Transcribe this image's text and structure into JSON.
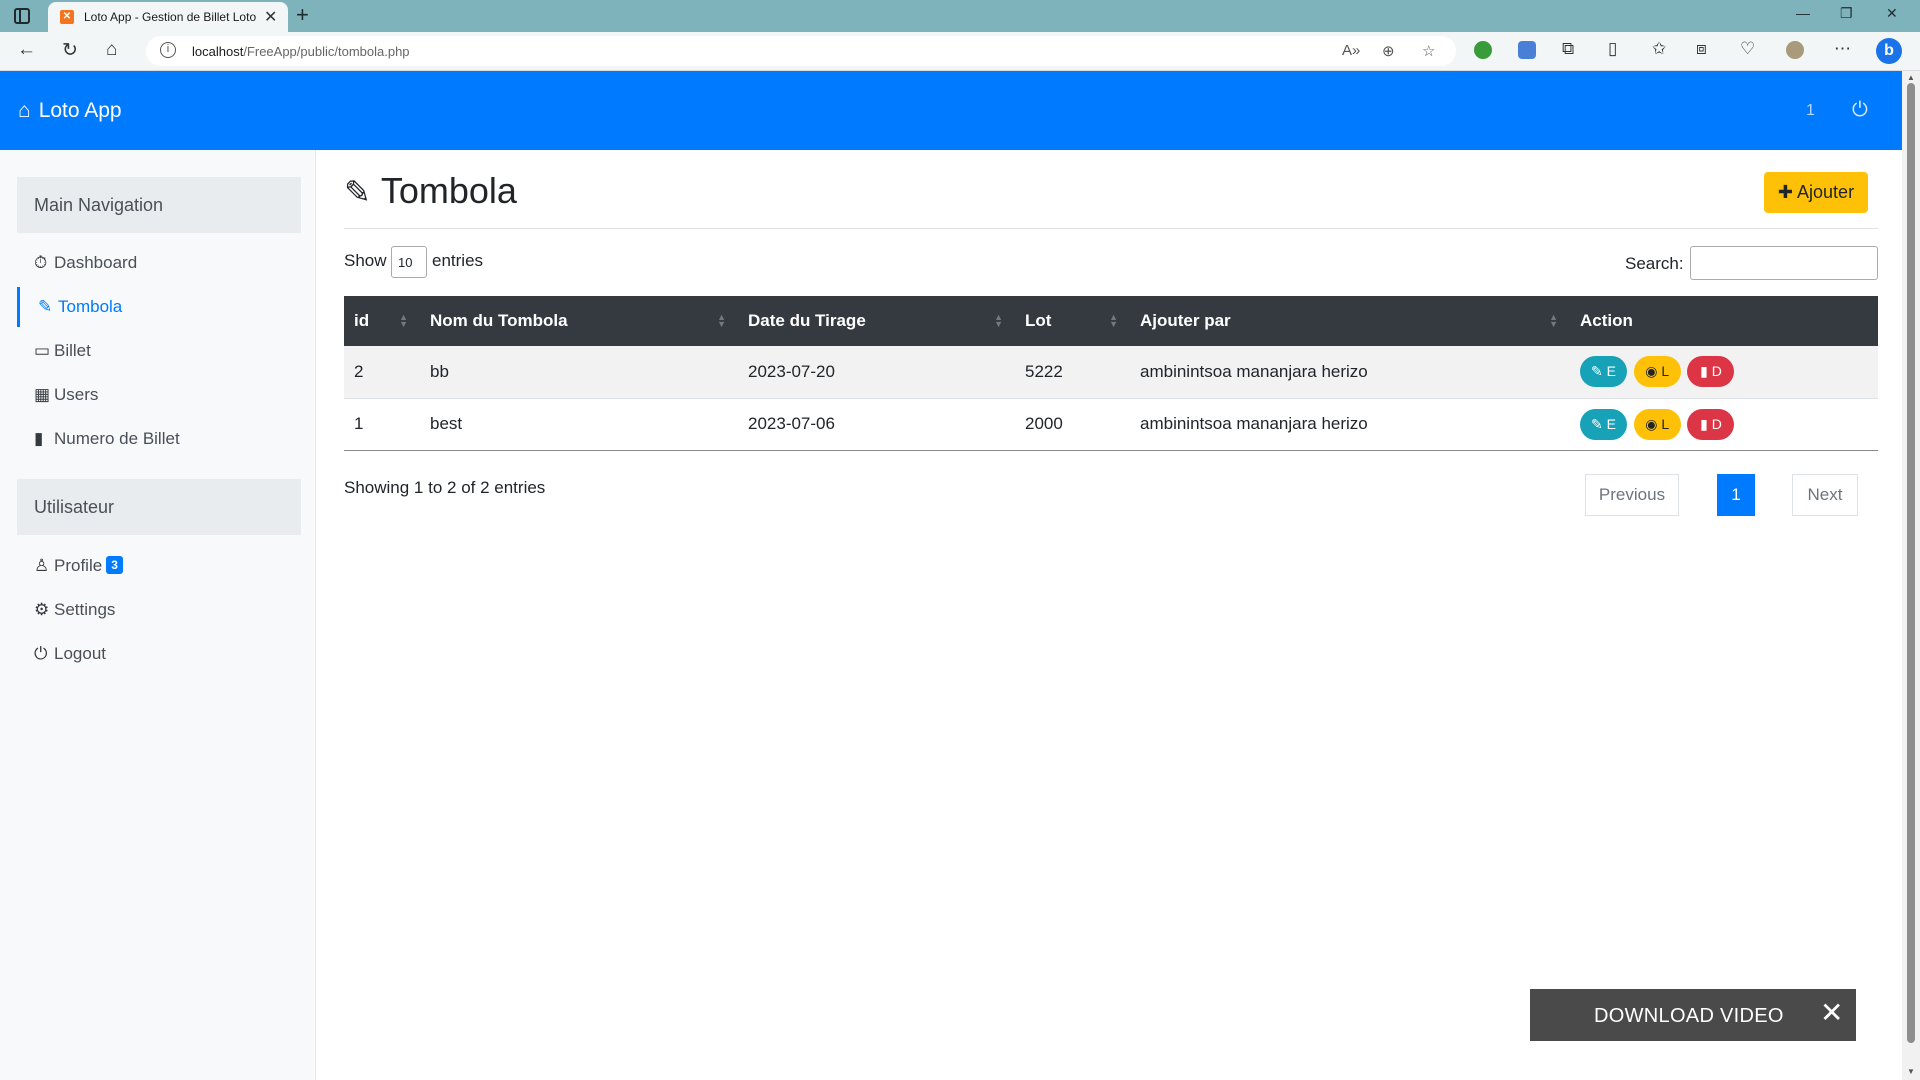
{
  "browser": {
    "tab_title": "Loto App - Gestion de Billet Loto",
    "tab_close": "✕",
    "new_tab": "+",
    "url_host": "localhost",
    "url_path": "/FreeApp/public/tombola.php",
    "read_aloud": "A»",
    "window": {
      "minimize": "—",
      "restore": "❐",
      "close": "✕"
    }
  },
  "navbar": {
    "brand": "Loto App",
    "count": "1",
    "power_icon": "⏻"
  },
  "sidebar": {
    "main_heading": "Main Navigation",
    "items": [
      {
        "label": "Dashboard",
        "icon": "⏱",
        "active": false
      },
      {
        "label": "Tombola",
        "icon": "✎",
        "active": true
      },
      {
        "label": "Billet",
        "icon": "▭",
        "active": false
      },
      {
        "label": "Users",
        "icon": "▦",
        "active": false
      },
      {
        "label": "Numero de Billet",
        "icon": "▮",
        "active": false
      }
    ],
    "user_heading": "Utilisateur",
    "user_items": [
      {
        "label": "Profile",
        "icon": "♙",
        "badge": "3"
      },
      {
        "label": "Settings",
        "icon": "⚙"
      },
      {
        "label": "Logout",
        "icon": "⏻"
      }
    ]
  },
  "main": {
    "title": "Tombola",
    "add_button": "Ajouter",
    "show_label": "Show",
    "page_length": "10",
    "entries_label": "entries",
    "search_label": "Search:",
    "search_value": "",
    "columns": [
      "id",
      "Nom du Tombola",
      "Date du Tirage",
      "Lot",
      "Ajouter par",
      "Action"
    ],
    "rows": [
      {
        "id": "2",
        "nom": "bb",
        "date": "2023-07-20",
        "lot": "5222",
        "ajouter_par": "ambinintsoa mananjara herizo"
      },
      {
        "id": "1",
        "nom": "best",
        "date": "2023-07-06",
        "lot": "2000",
        "ajouter_par": "ambinintsoa mananjara herizo"
      }
    ],
    "actions": {
      "edit": "E",
      "view": "L",
      "delete": "D"
    },
    "info": "Showing 1 to 2 of 2 entries",
    "pagination": {
      "previous": "Previous",
      "current": "1",
      "next": "Next"
    }
  },
  "overlay": {
    "download_label": "DOWNLOAD VIDEO",
    "close": "✕"
  },
  "colors": {
    "navbar": "#007bff",
    "add_button": "#ffc107",
    "edit": "#17a2b8",
    "view": "#ffc107",
    "delete": "#dc3545",
    "table_header": "#343a40"
  }
}
